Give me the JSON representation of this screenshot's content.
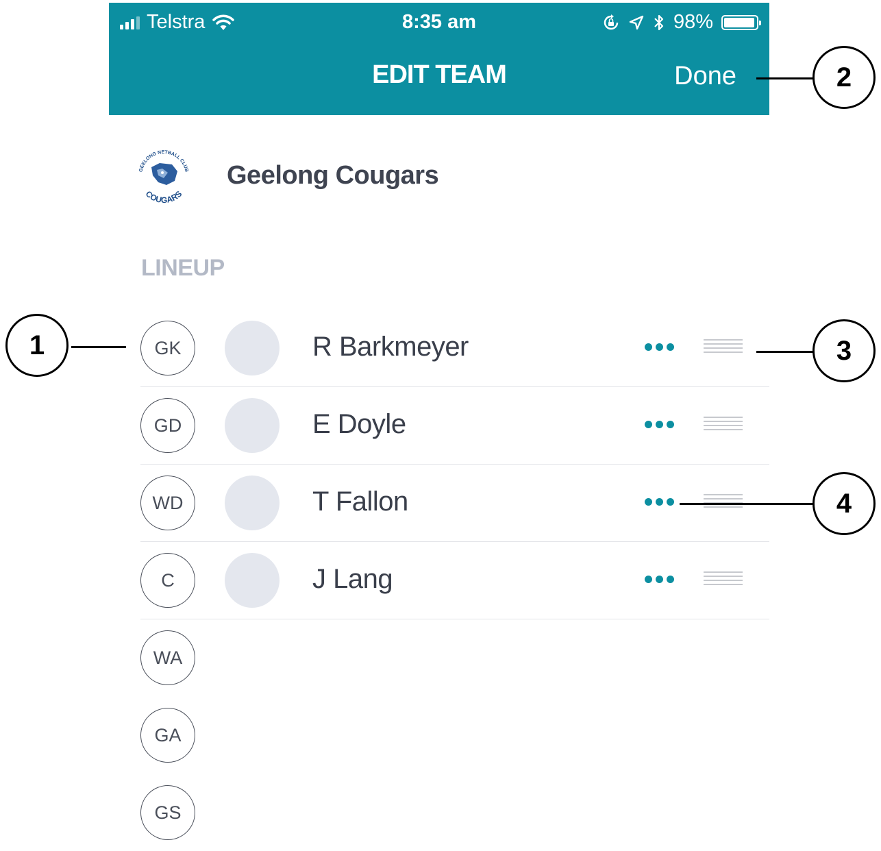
{
  "status_bar": {
    "carrier": "Telstra",
    "time": "8:35 am",
    "battery": "98%"
  },
  "nav": {
    "title": "EDIT TEAM",
    "done_label": "Done"
  },
  "team": {
    "name": "Geelong Cougars",
    "logo_text": "GEELONG NETBALL CLUB",
    "logo_wordmark": "COUGARS"
  },
  "lineup": {
    "heading": "LINEUP",
    "rows": [
      {
        "position": "GK",
        "player": "R Barkmeyer"
      },
      {
        "position": "GD",
        "player": "E Doyle"
      },
      {
        "position": "WD",
        "player": "T Fallon"
      },
      {
        "position": "C",
        "player": "J Lang"
      },
      {
        "position": "WA",
        "player": ""
      },
      {
        "position": "GA",
        "player": ""
      },
      {
        "position": "GS",
        "player": ""
      }
    ]
  },
  "callouts": [
    "1",
    "2",
    "3",
    "4"
  ],
  "colors": {
    "accent": "#0c8fa1",
    "position_ring": "#4a4f5a",
    "section_heading": "#b3b9c6",
    "avatar_placeholder": "#e4e7ee"
  }
}
